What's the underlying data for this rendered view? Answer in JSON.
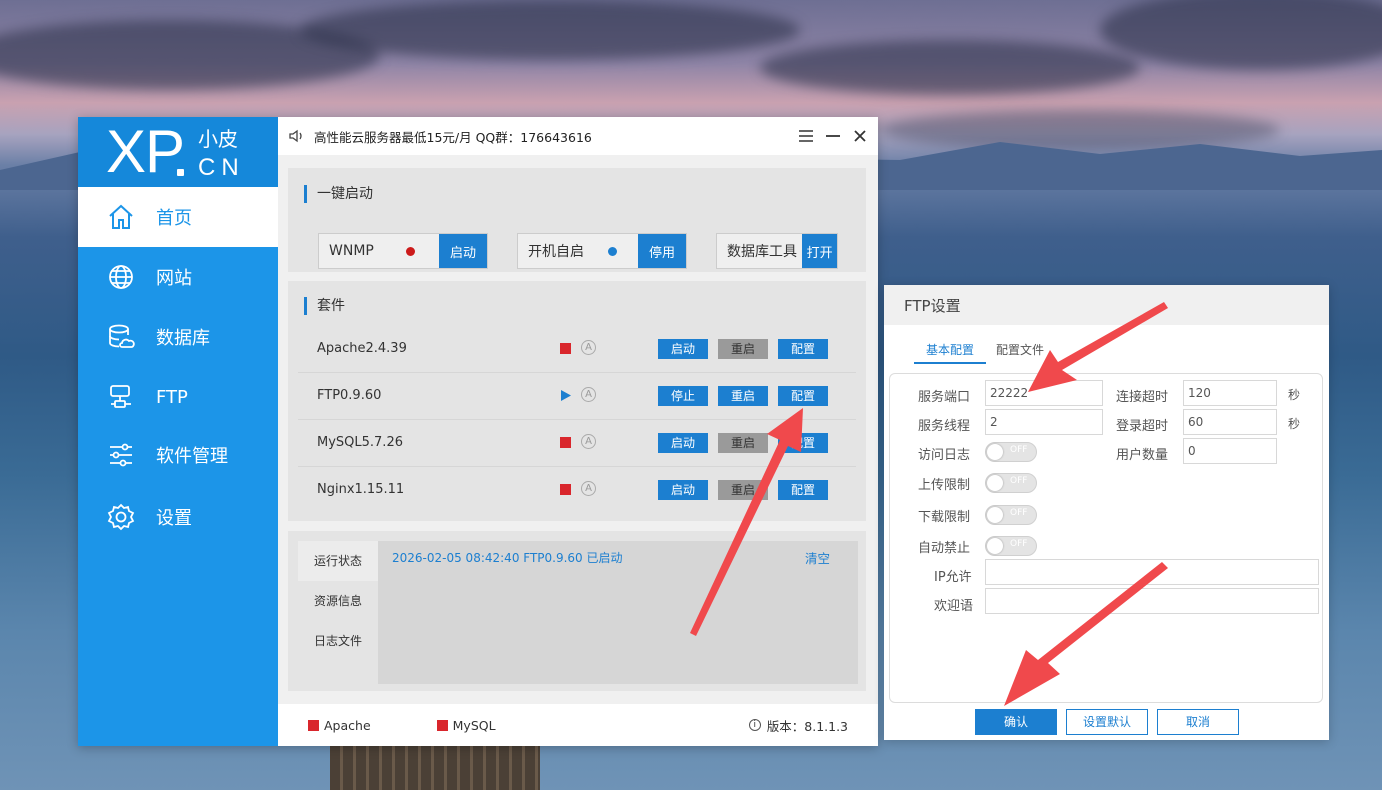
{
  "app": {
    "logo": {
      "brand": "XP",
      "small": "小皮",
      "domain": "CN"
    },
    "nav": [
      {
        "label": "首页",
        "icon": "home-icon",
        "active": true
      },
      {
        "label": "网站",
        "icon": "globe-icon",
        "active": false
      },
      {
        "label": "数据库",
        "icon": "database-icon",
        "active": false
      },
      {
        "label": "FTP",
        "icon": "ftp-icon",
        "active": false
      },
      {
        "label": "软件管理",
        "icon": "sliders-icon",
        "active": false
      },
      {
        "label": "设置",
        "icon": "gear-icon",
        "active": false
      }
    ],
    "titlebar": {
      "notice": "高性能云服务器最低15元/月  QQ群：176643616"
    },
    "quick_start": {
      "title": "一键启动",
      "wnmp": {
        "label": "WNMP",
        "button": "启动",
        "status_color": "#cc1a1a"
      },
      "autostart": {
        "label": "开机自启",
        "button": "停用",
        "status_color": "#1c7fd0"
      },
      "dbtool": {
        "label": "数据库工具",
        "button": "打开"
      }
    },
    "packages": {
      "title": "套件",
      "rows": [
        {
          "name": "Apache2.4.39",
          "status": "stopped",
          "btn1": "启动",
          "btn2": "重启",
          "btn3": "配置"
        },
        {
          "name": "FTP0.9.60",
          "status": "running",
          "btn1": "停止",
          "btn2": "重启",
          "btn3": "配置"
        },
        {
          "name": "MySQL5.7.26",
          "status": "stopped",
          "btn1": "启动",
          "btn2": "重启",
          "btn3": "配置"
        },
        {
          "name": "Nginx1.15.11",
          "status": "stopped",
          "btn1": "启动",
          "btn2": "重启",
          "btn3": "配置"
        }
      ]
    },
    "log": {
      "tabs": [
        "运行状态",
        "资源信息",
        "日志文件"
      ],
      "entry": "2026-02-05 08:42:40 FTP0.9.60 已启动",
      "clear": "清空"
    },
    "footer": {
      "apache": "Apache",
      "mysql": "MySQL",
      "version": "版本：8.1.1.3"
    }
  },
  "ftp_dialog": {
    "title": "FTP设置",
    "tabs": [
      "基本配置",
      "配置文件"
    ],
    "fields": {
      "port_label": "服务端口",
      "port_value": "22222",
      "threads_label": "服务线程",
      "threads_value": "2",
      "conn_timeout_label": "连接超时",
      "conn_timeout_value": "120",
      "conn_timeout_unit": "秒",
      "login_timeout_label": "登录超时",
      "login_timeout_value": "60",
      "login_timeout_unit": "秒",
      "user_count_label": "用户数量",
      "user_count_value": "0",
      "access_log_label": "访问日志",
      "upload_limit_label": "上传限制",
      "download_limit_label": "下载限制",
      "auto_ban_label": "自动禁止",
      "toggle_off": "OFF",
      "ip_allow_label": "IP允许",
      "ip_allow_value": "",
      "welcome_label": "欢迎语",
      "welcome_value": ""
    },
    "buttons": {
      "confirm": "确认",
      "defaults": "设置默认",
      "cancel": "取消"
    }
  },
  "colors": {
    "accent": "#1c95e8",
    "button": "#1c7fd0",
    "stopped": "#d9262c",
    "arrow": "#f0494c"
  }
}
